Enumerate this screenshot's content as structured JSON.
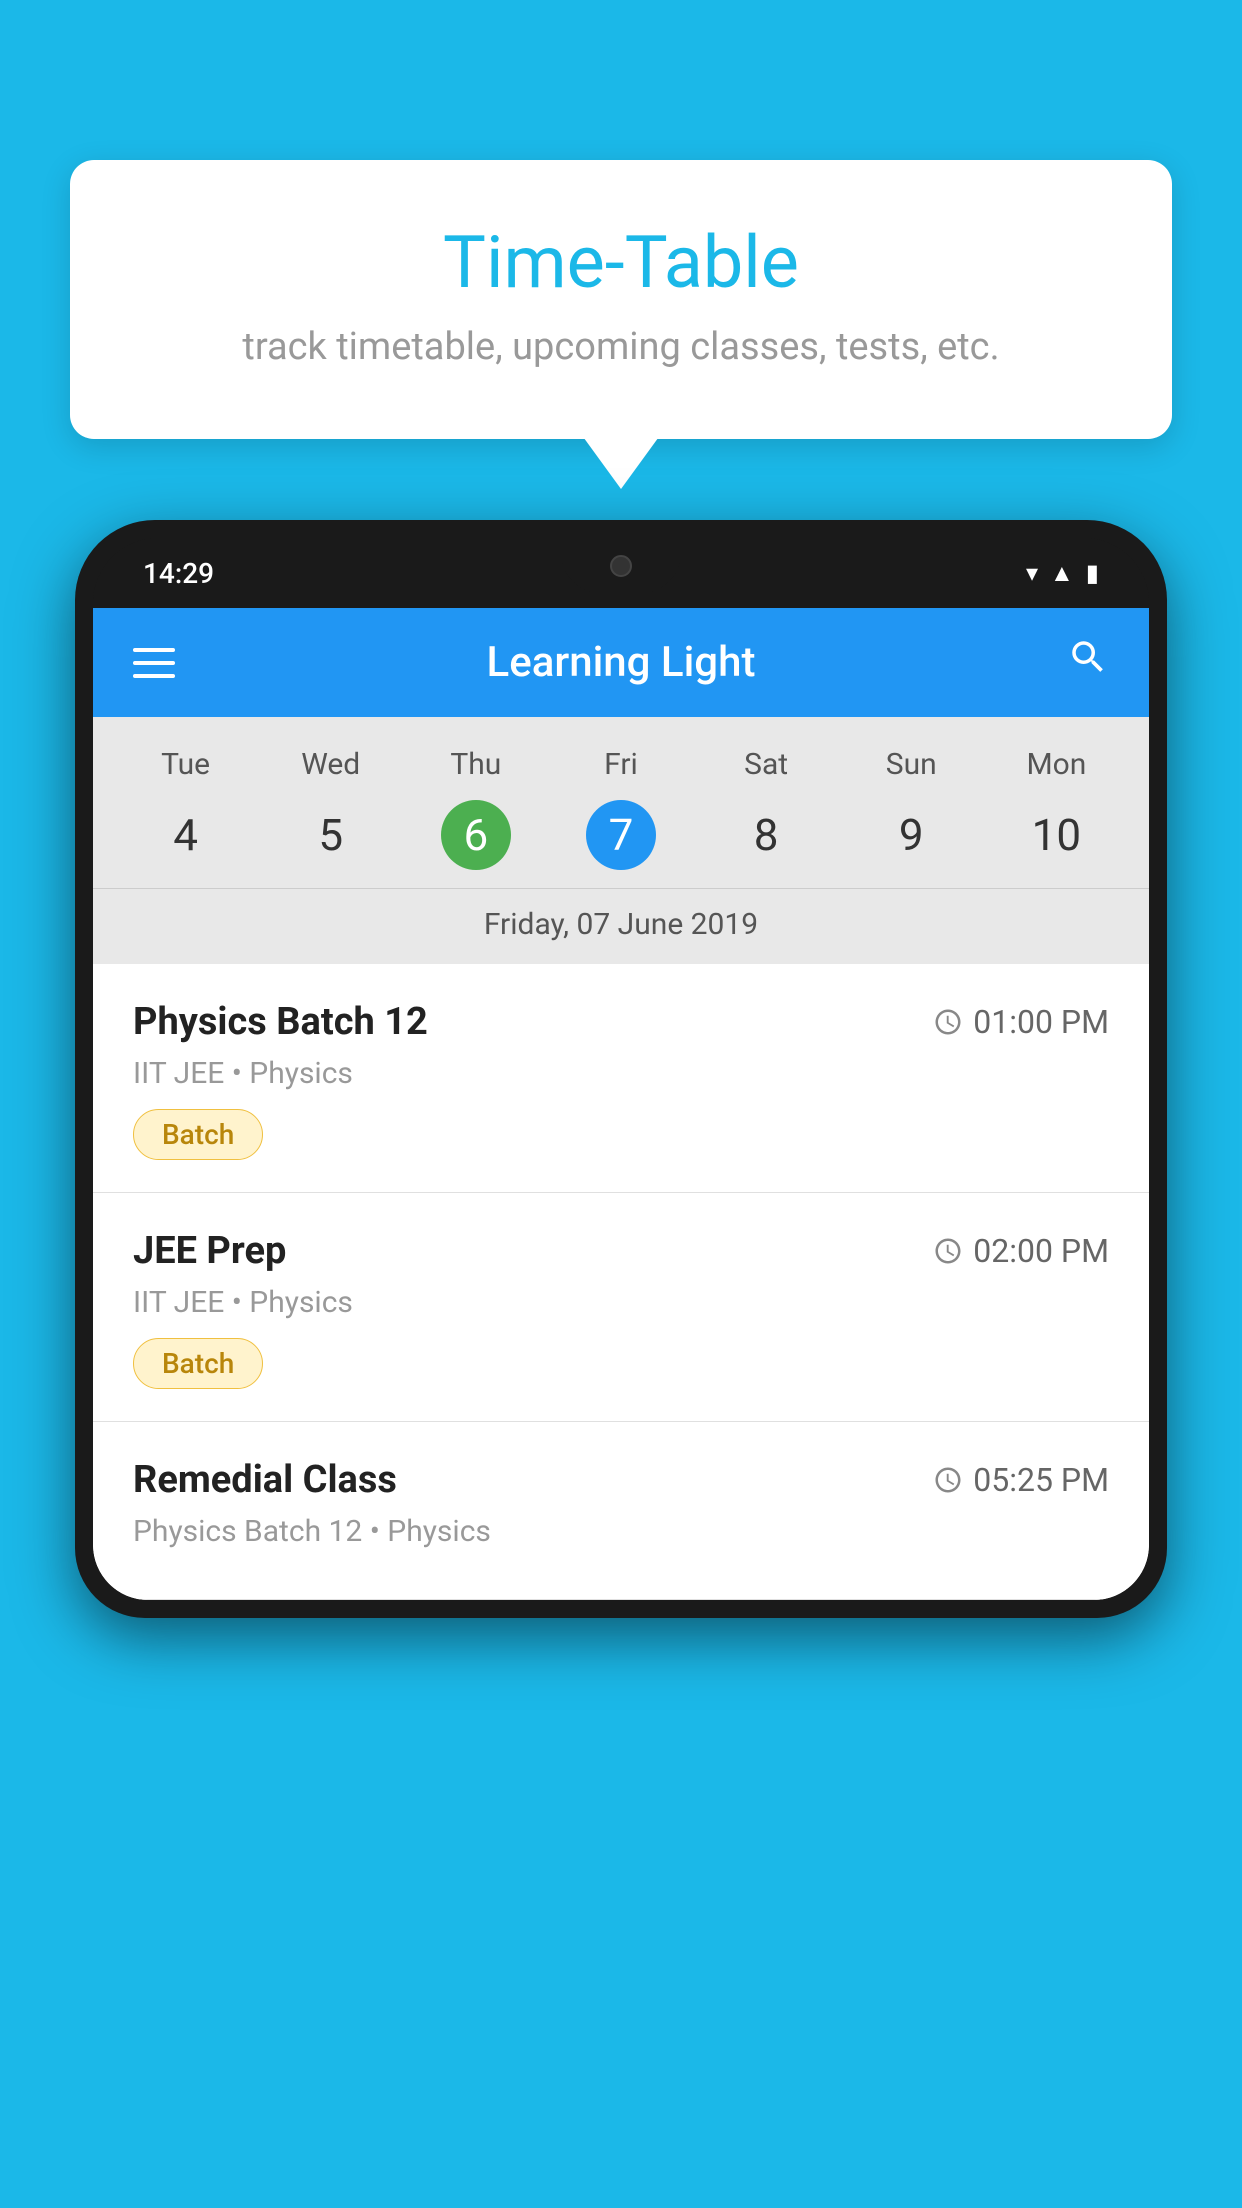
{
  "background_color": "#1BB8E8",
  "tooltip": {
    "title": "Time-Table",
    "subtitle": "track timetable, upcoming classes, tests, etc."
  },
  "phone": {
    "status_bar": {
      "time": "14:29"
    },
    "app_bar": {
      "title": "Learning Light",
      "menu_icon": "hamburger-icon",
      "search_icon": "search-icon"
    },
    "calendar": {
      "days": [
        {
          "label": "Tue",
          "num": "4",
          "state": "normal"
        },
        {
          "label": "Wed",
          "num": "5",
          "state": "normal"
        },
        {
          "label": "Thu",
          "num": "6",
          "state": "today"
        },
        {
          "label": "Fri",
          "num": "7",
          "state": "selected"
        },
        {
          "label": "Sat",
          "num": "8",
          "state": "normal"
        },
        {
          "label": "Sun",
          "num": "9",
          "state": "normal"
        },
        {
          "label": "Mon",
          "num": "10",
          "state": "normal"
        }
      ],
      "selected_date": "Friday, 07 June 2019"
    },
    "schedule": [
      {
        "title": "Physics Batch 12",
        "time": "01:00 PM",
        "sub": "IIT JEE • Physics",
        "tag": "Batch"
      },
      {
        "title": "JEE Prep",
        "time": "02:00 PM",
        "sub": "IIT JEE • Physics",
        "tag": "Batch"
      },
      {
        "title": "Remedial Class",
        "time": "05:25 PM",
        "sub": "Physics Batch 12 • Physics",
        "tag": null
      }
    ]
  }
}
